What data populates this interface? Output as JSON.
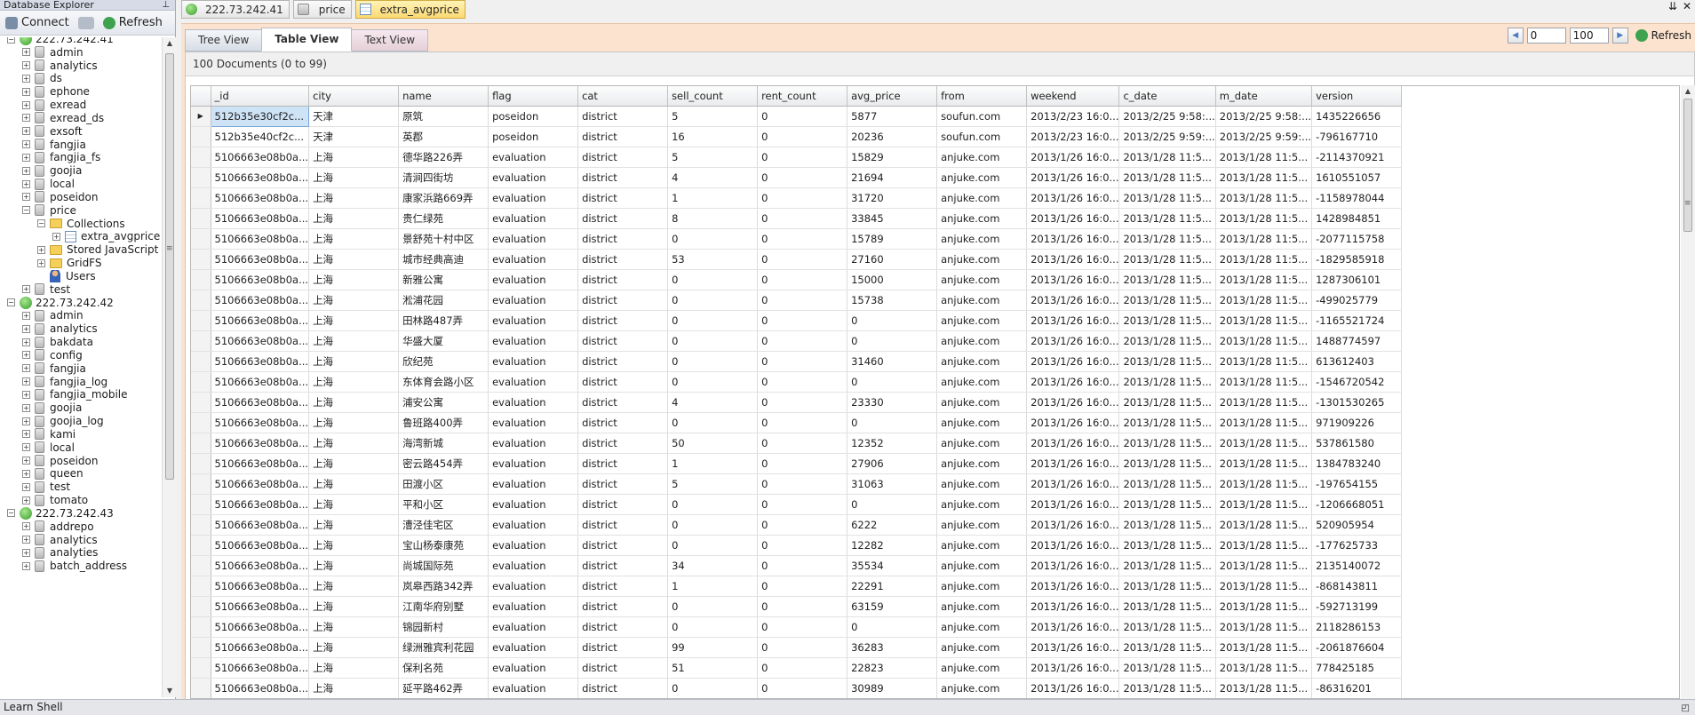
{
  "left_panel": {
    "title": "Database Explorer",
    "pin_icon": "pin-icon",
    "connect_label": "Connect",
    "refresh_label": "Refresh",
    "tree": [
      {
        "level": 0,
        "type": "server",
        "label": "222.73.242.41",
        "expanded": true
      },
      {
        "level": 1,
        "type": "db",
        "label": "admin"
      },
      {
        "level": 1,
        "type": "db",
        "label": "analytics"
      },
      {
        "level": 1,
        "type": "db",
        "label": "ds"
      },
      {
        "level": 1,
        "type": "db",
        "label": "ephone"
      },
      {
        "level": 1,
        "type": "db",
        "label": "exread"
      },
      {
        "level": 1,
        "type": "db",
        "label": "exread_ds"
      },
      {
        "level": 1,
        "type": "db",
        "label": "exsoft"
      },
      {
        "level": 1,
        "type": "db",
        "label": "fangjia"
      },
      {
        "level": 1,
        "type": "db",
        "label": "fangjia_fs"
      },
      {
        "level": 1,
        "type": "db",
        "label": "goojia"
      },
      {
        "level": 1,
        "type": "db",
        "label": "local"
      },
      {
        "level": 1,
        "type": "db",
        "label": "poseidon"
      },
      {
        "level": 1,
        "type": "db",
        "label": "price",
        "expanded": true
      },
      {
        "level": 2,
        "type": "folder",
        "label": "Collections",
        "expanded": true
      },
      {
        "level": 3,
        "type": "collection",
        "label": "extra_avgprice"
      },
      {
        "level": 2,
        "type": "folder",
        "label": "Stored JavaScript"
      },
      {
        "level": 2,
        "type": "folder",
        "label": "GridFS"
      },
      {
        "level": 2,
        "type": "users",
        "label": "Users"
      },
      {
        "level": 1,
        "type": "db",
        "label": "test"
      },
      {
        "level": 0,
        "type": "server",
        "label": "222.73.242.42",
        "expanded": true
      },
      {
        "level": 1,
        "type": "db",
        "label": "admin"
      },
      {
        "level": 1,
        "type": "db",
        "label": "analytics"
      },
      {
        "level": 1,
        "type": "db",
        "label": "bakdata"
      },
      {
        "level": 1,
        "type": "db",
        "label": "config"
      },
      {
        "level": 1,
        "type": "db",
        "label": "fangjia"
      },
      {
        "level": 1,
        "type": "db",
        "label": "fangjia_log"
      },
      {
        "level": 1,
        "type": "db",
        "label": "fangjia_mobile"
      },
      {
        "level": 1,
        "type": "db",
        "label": "goojia"
      },
      {
        "level": 1,
        "type": "db",
        "label": "goojia_log"
      },
      {
        "level": 1,
        "type": "db",
        "label": "kami"
      },
      {
        "level": 1,
        "type": "db",
        "label": "local"
      },
      {
        "level": 1,
        "type": "db",
        "label": "poseidon"
      },
      {
        "level": 1,
        "type": "db",
        "label": "queen"
      },
      {
        "level": 1,
        "type": "db",
        "label": "test"
      },
      {
        "level": 1,
        "type": "db",
        "label": "tomato"
      },
      {
        "level": 0,
        "type": "server",
        "label": "222.73.242.43",
        "expanded": true
      },
      {
        "level": 1,
        "type": "db",
        "label": "addrepo"
      },
      {
        "level": 1,
        "type": "db",
        "label": "analytics"
      },
      {
        "level": 1,
        "type": "db",
        "label": "analyties"
      },
      {
        "level": 1,
        "type": "db",
        "label": "batch_address"
      }
    ]
  },
  "doc_tabs": [
    {
      "label": "222.73.242.41",
      "icon": "server-icon",
      "active": false
    },
    {
      "label": "price",
      "icon": "database-icon",
      "active": false
    },
    {
      "label": "extra_avgprice",
      "icon": "collection-icon",
      "active": true
    }
  ],
  "view_tabs": {
    "tree": "Tree View",
    "table": "Table View",
    "text": "Text View"
  },
  "pager": {
    "skip": "0",
    "limit": "100",
    "refresh_label": "Refresh"
  },
  "count_text": "100 Documents (0 to 99)",
  "table": {
    "columns": [
      "_id",
      "city",
      "name",
      "flag",
      "cat",
      "sell_count",
      "rent_count",
      "avg_price",
      "from",
      "weekend",
      "c_date",
      "m_date",
      "version"
    ],
    "rows": [
      [
        "512b35e30cf2c...",
        "天津",
        "原筑",
        "poseidon",
        "district",
        "5",
        "0",
        "5877",
        "soufun.com",
        "2013/2/23 16:0...",
        "2013/2/25 9:58:...",
        "2013/2/25 9:58:...",
        "1435226656"
      ],
      [
        "512b35e40cf2c...",
        "天津",
        "英郡",
        "poseidon",
        "district",
        "16",
        "0",
        "20236",
        "soufun.com",
        "2013/2/23 16:0...",
        "2013/2/25 9:59:...",
        "2013/2/25 9:59:...",
        "-796167710"
      ],
      [
        "5106663e08b0a...",
        "上海",
        "德华路226弄",
        "evaluation",
        "district",
        "5",
        "0",
        "15829",
        "anjuke.com",
        "2013/1/26 16:0...",
        "2013/1/28 11:5...",
        "2013/1/28 11:5...",
        "-2114370921"
      ],
      [
        "5106663e08b0a...",
        "上海",
        "清涧四街坊",
        "evaluation",
        "district",
        "4",
        "0",
        "21694",
        "anjuke.com",
        "2013/1/26 16:0...",
        "2013/1/28 11:5...",
        "2013/1/28 11:5...",
        "1610551057"
      ],
      [
        "5106663e08b0a...",
        "上海",
        "康家浜路669弄",
        "evaluation",
        "district",
        "1",
        "0",
        "31720",
        "anjuke.com",
        "2013/1/26 16:0...",
        "2013/1/28 11:5...",
        "2013/1/28 11:5...",
        "-1158978044"
      ],
      [
        "5106663e08b0a...",
        "上海",
        "贵仁绿苑",
        "evaluation",
        "district",
        "8",
        "0",
        "33845",
        "anjuke.com",
        "2013/1/26 16:0...",
        "2013/1/28 11:5...",
        "2013/1/28 11:5...",
        "1428984851"
      ],
      [
        "5106663e08b0a...",
        "上海",
        "景舒苑十村中区",
        "evaluation",
        "district",
        "0",
        "0",
        "15789",
        "anjuke.com",
        "2013/1/26 16:0...",
        "2013/1/28 11:5...",
        "2013/1/28 11:5...",
        "-2077115758"
      ],
      [
        "5106663e08b0a...",
        "上海",
        "城市经典高迪",
        "evaluation",
        "district",
        "53",
        "0",
        "27160",
        "anjuke.com",
        "2013/1/26 16:0...",
        "2013/1/28 11:5...",
        "2013/1/28 11:5...",
        "-1829585918"
      ],
      [
        "5106663e08b0a...",
        "上海",
        "新雅公寓",
        "evaluation",
        "district",
        "0",
        "0",
        "15000",
        "anjuke.com",
        "2013/1/26 16:0...",
        "2013/1/28 11:5...",
        "2013/1/28 11:5...",
        "1287306101"
      ],
      [
        "5106663e08b0a...",
        "上海",
        "淞浦花园",
        "evaluation",
        "district",
        "0",
        "0",
        "15738",
        "anjuke.com",
        "2013/1/26 16:0...",
        "2013/1/28 11:5...",
        "2013/1/28 11:5...",
        "-499025779"
      ],
      [
        "5106663e08b0a...",
        "上海",
        "田林路487弄",
        "evaluation",
        "district",
        "0",
        "0",
        "0",
        "anjuke.com",
        "2013/1/26 16:0...",
        "2013/1/28 11:5...",
        "2013/1/28 11:5...",
        "-1165521724"
      ],
      [
        "5106663e08b0a...",
        "上海",
        "华盛大厦",
        "evaluation",
        "district",
        "0",
        "0",
        "0",
        "anjuke.com",
        "2013/1/26 16:0...",
        "2013/1/28 11:5...",
        "2013/1/28 11:5...",
        "1488774597"
      ],
      [
        "5106663e08b0a...",
        "上海",
        "欣纪苑",
        "evaluation",
        "district",
        "0",
        "0",
        "31460",
        "anjuke.com",
        "2013/1/26 16:0...",
        "2013/1/28 11:5...",
        "2013/1/28 11:5...",
        "613612403"
      ],
      [
        "5106663e08b0a...",
        "上海",
        "东体育会路小区",
        "evaluation",
        "district",
        "0",
        "0",
        "0",
        "anjuke.com",
        "2013/1/26 16:0...",
        "2013/1/28 11:5...",
        "2013/1/28 11:5...",
        "-1546720542"
      ],
      [
        "5106663e08b0a...",
        "上海",
        "浦安公寓",
        "evaluation",
        "district",
        "4",
        "0",
        "23330",
        "anjuke.com",
        "2013/1/26 16:0...",
        "2013/1/28 11:5...",
        "2013/1/28 11:5...",
        "-1301530265"
      ],
      [
        "5106663e08b0a...",
        "上海",
        "鲁班路400弄",
        "evaluation",
        "district",
        "0",
        "0",
        "0",
        "anjuke.com",
        "2013/1/26 16:0...",
        "2013/1/28 11:5...",
        "2013/1/28 11:5...",
        "971909226"
      ],
      [
        "5106663e08b0a...",
        "上海",
        "海湾新城",
        "evaluation",
        "district",
        "50",
        "0",
        "12352",
        "anjuke.com",
        "2013/1/26 16:0...",
        "2013/1/28 11:5...",
        "2013/1/28 11:5...",
        "537861580"
      ],
      [
        "5106663e08b0a...",
        "上海",
        "密云路454弄",
        "evaluation",
        "district",
        "1",
        "0",
        "27906",
        "anjuke.com",
        "2013/1/26 16:0...",
        "2013/1/28 11:5...",
        "2013/1/28 11:5...",
        "1384783240"
      ],
      [
        "5106663e08b0a...",
        "上海",
        "田渡小区",
        "evaluation",
        "district",
        "5",
        "0",
        "31063",
        "anjuke.com",
        "2013/1/26 16:0...",
        "2013/1/28 11:5...",
        "2013/1/28 11:5...",
        "-197654155"
      ],
      [
        "5106663e08b0a...",
        "上海",
        "平和小区",
        "evaluation",
        "district",
        "0",
        "0",
        "0",
        "anjuke.com",
        "2013/1/26 16:0...",
        "2013/1/28 11:5...",
        "2013/1/28 11:5...",
        "-1206668051"
      ],
      [
        "5106663e08b0a...",
        "上海",
        "漕泾佳宅区",
        "evaluation",
        "district",
        "0",
        "0",
        "6222",
        "anjuke.com",
        "2013/1/26 16:0...",
        "2013/1/28 11:5...",
        "2013/1/28 11:5...",
        "520905954"
      ],
      [
        "5106663e08b0a...",
        "上海",
        "宝山杨泰康苑",
        "evaluation",
        "district",
        "0",
        "0",
        "12282",
        "anjuke.com",
        "2013/1/26 16:0...",
        "2013/1/28 11:5...",
        "2013/1/28 11:5...",
        "-177625733"
      ],
      [
        "5106663e08b0a...",
        "上海",
        "尚城国际苑",
        "evaluation",
        "district",
        "34",
        "0",
        "35534",
        "anjuke.com",
        "2013/1/26 16:0...",
        "2013/1/28 11:5...",
        "2013/1/28 11:5...",
        "2135140072"
      ],
      [
        "5106663e08b0a...",
        "上海",
        "岚皋西路342弄",
        "evaluation",
        "district",
        "1",
        "0",
        "22291",
        "anjuke.com",
        "2013/1/26 16:0...",
        "2013/1/28 11:5...",
        "2013/1/28 11:5...",
        "-868143811"
      ],
      [
        "5106663e08b0a...",
        "上海",
        "江南华府别墅",
        "evaluation",
        "district",
        "0",
        "0",
        "63159",
        "anjuke.com",
        "2013/1/26 16:0...",
        "2013/1/28 11:5...",
        "2013/1/28 11:5...",
        "-592713199"
      ],
      [
        "5106663e08b0a...",
        "上海",
        "锦园新村",
        "evaluation",
        "district",
        "0",
        "0",
        "0",
        "anjuke.com",
        "2013/1/26 16:0...",
        "2013/1/28 11:5...",
        "2013/1/28 11:5...",
        "2118286153"
      ],
      [
        "5106663e08b0a...",
        "上海",
        "绿洲雅宾利花园",
        "evaluation",
        "district",
        "99",
        "0",
        "36283",
        "anjuke.com",
        "2013/1/26 16:0...",
        "2013/1/28 11:5...",
        "2013/1/28 11:5...",
        "-2061876604"
      ],
      [
        "5106663e08b0a...",
        "上海",
        "保利名苑",
        "evaluation",
        "district",
        "51",
        "0",
        "22823",
        "anjuke.com",
        "2013/1/26 16:0...",
        "2013/1/28 11:5...",
        "2013/1/28 11:5...",
        "778425185"
      ],
      [
        "5106663e08b0a...",
        "上海",
        "延平路462弄",
        "evaluation",
        "district",
        "0",
        "0",
        "30989",
        "anjuke.com",
        "2013/1/26 16:0...",
        "2013/1/28 11:5...",
        "2013/1/28 11:5...",
        "-86316201"
      ]
    ]
  },
  "status_bar": {
    "label": "Learn Shell"
  }
}
